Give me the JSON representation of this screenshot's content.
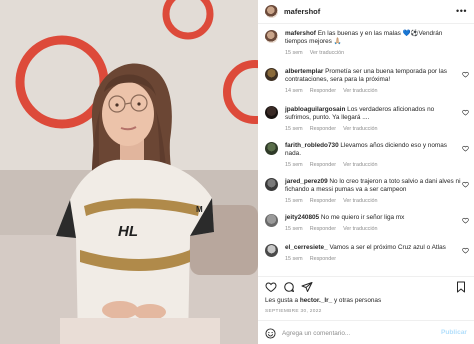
{
  "colors": {
    "accent": "#0095f6",
    "accent_disabled": "#b2dffc",
    "muted": "#8e8e8e",
    "text": "#262626",
    "ring": "#e0493b"
  },
  "post": {
    "username": "mafershof",
    "caption_user": "mafershof",
    "caption_text": "En las buenas y en las malas 💙⚽️Vendrán tiempos mejores 🙏🏼",
    "caption_time": "15 sem",
    "caption_translate": "Ver traducción"
  },
  "comments": [
    {
      "user": "albertemplar",
      "text": "Prometía ser una buena temporada por las contrataciones, sera para la próxima!",
      "time": "14 sem",
      "reply": "Responder",
      "translate": "Ver traducción"
    },
    {
      "user": "jpabloaguilargosain",
      "text": "Los verdaderos aficionados no sufrimos, punto. Ya llegará ....",
      "time": "15 sem",
      "reply": "Responder",
      "translate": "Ver traducción"
    },
    {
      "user": "farith_robledo730",
      "text": "Llevamos años diciendo eso y nomas nada.",
      "time": "15 sem",
      "reply": "Responder",
      "translate": "Ver traducción"
    },
    {
      "user": "jared_perez09",
      "text": "No lo creo trajeron a toto salvio a dani alves ni fichando a messi pumas va a ser campeon",
      "time": "15 sem",
      "reply": "Responder",
      "translate": "Ver traducción"
    },
    {
      "user": "jeity240805",
      "text": "No me quiero ir señor liga mx",
      "time": "15 sem",
      "reply": "Responder",
      "translate": "Ver traducción"
    },
    {
      "user": "el_cerresiete_",
      "text": "Vamos a ser el próximo Cruz azul o Atlas",
      "time": "15 sem",
      "reply": "Responder",
      "translate": ""
    }
  ],
  "likes": {
    "prefix": "Les gusta a",
    "user": "hector._lr_",
    "suffix": "y otras personas"
  },
  "date": "SEPTIEMBRE 30, 2022",
  "add_comment": {
    "placeholder": "Agrega un comentario...",
    "publish": "Publicar"
  },
  "icons": {
    "more": "more-dots-icon",
    "like": "heart-icon",
    "comment": "comment-bubble-icon",
    "share": "paper-plane-icon",
    "save": "bookmark-icon",
    "emoji": "smile-icon"
  }
}
